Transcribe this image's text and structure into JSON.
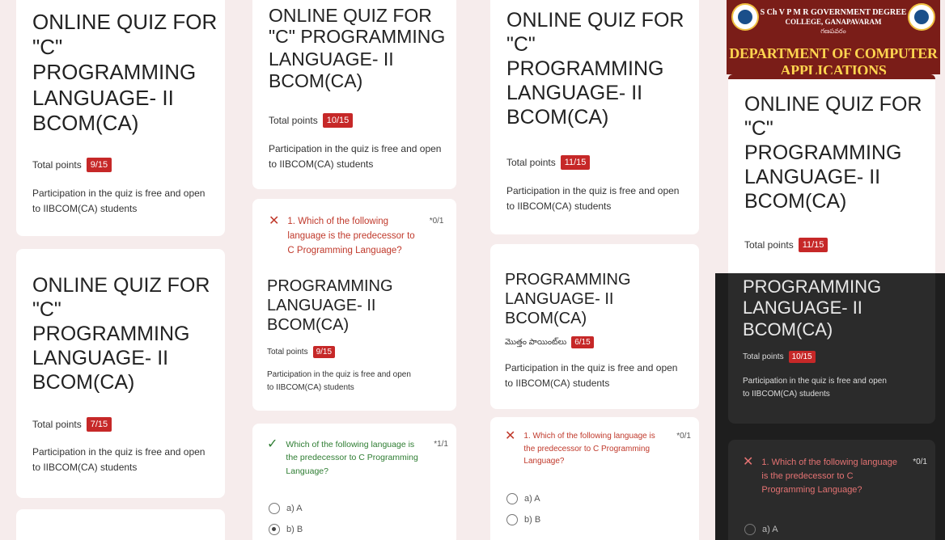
{
  "quiz": {
    "title_lines": [
      "ONLINE QUIZ FOR",
      "\"C\"",
      "PROGRAMMING",
      "LANGUAGE- II",
      "BCOM(CA)"
    ],
    "total_points_label": "Total points",
    "total_points_label_telugu": "మొత్తం పాయింట్‌లు",
    "description_line1": "Participation in the quiz is free and open",
    "description_line2": "to IIBCOM(CA) students",
    "question1_line1": "1. Which of the following",
    "question1_line2": "language is the predecessor to",
    "question1_line3": "C Programming Language?",
    "question1_points_wrong": "*0/1",
    "question1_points_right": "*1/1",
    "option_a": "a) A",
    "option_b": "b) B"
  },
  "banner": {
    "college_line1": "S Ch V P M R GOVERNMENT DEGREE",
    "college_line2": "COLLEGE, GANAPAVARAM",
    "college_line3": "గణపవరం",
    "department": "DEPARTMENT OF COMPUTER APPLICATIONS"
  },
  "scores": {
    "tile1": "9/15",
    "tile2": "10/15",
    "tile3": "11/15",
    "tile4": "11/15",
    "tile5": "7/15",
    "tile6": "9/15",
    "tile7": "6/15",
    "tile8": "10/15"
  },
  "colors": {
    "score_badge": "#c62828",
    "wrong": "#c0392b",
    "right": "#2e7d32",
    "banner": "#7a1d18"
  },
  "icons": {
    "wrong": "cross-icon",
    "right": "check-icon"
  }
}
